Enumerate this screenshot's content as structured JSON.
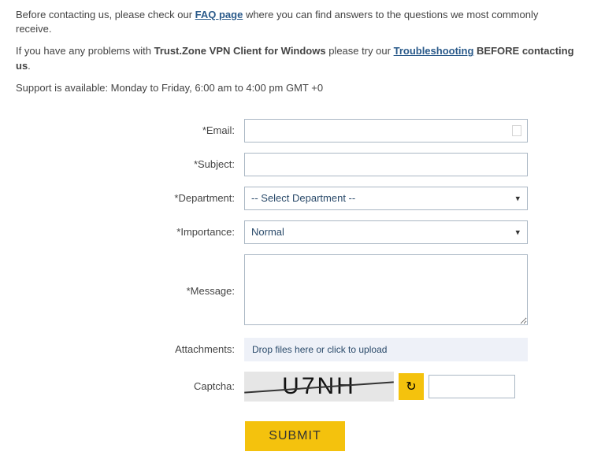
{
  "intro": {
    "line1_before": "Before contacting us, please check our ",
    "faq_link": "FAQ page",
    "line1_after": " where you can find answers to the questions we most commonly receive.",
    "line2_before": "If you have any problems with ",
    "product": "Trust.Zone VPN Client for Windows",
    "line2_mid": " please try our ",
    "troubleshoot_link": "Troubleshooting",
    "line2_after": " BEFORE contacting us",
    "line3": "Support is available: Monday to Friday, 6:00 am to 4:00 pm GMT +0"
  },
  "form": {
    "email_label": "*Email:",
    "email_value": "",
    "subject_label": "*Subject:",
    "subject_value": "",
    "department_label": "*Department:",
    "department_selected": "-- Select Department --",
    "importance_label": "*Importance:",
    "importance_selected": "Normal",
    "message_label": "*Message:",
    "message_value": "",
    "attachments_label": "Attachments:",
    "attachments_placeholder": "Drop files here or click to upload",
    "captcha_label": "Captcha:",
    "captcha_text": "U7NH",
    "captcha_refresh_icon": "↻",
    "captcha_value": "",
    "submit_label": "SUBMIT"
  }
}
